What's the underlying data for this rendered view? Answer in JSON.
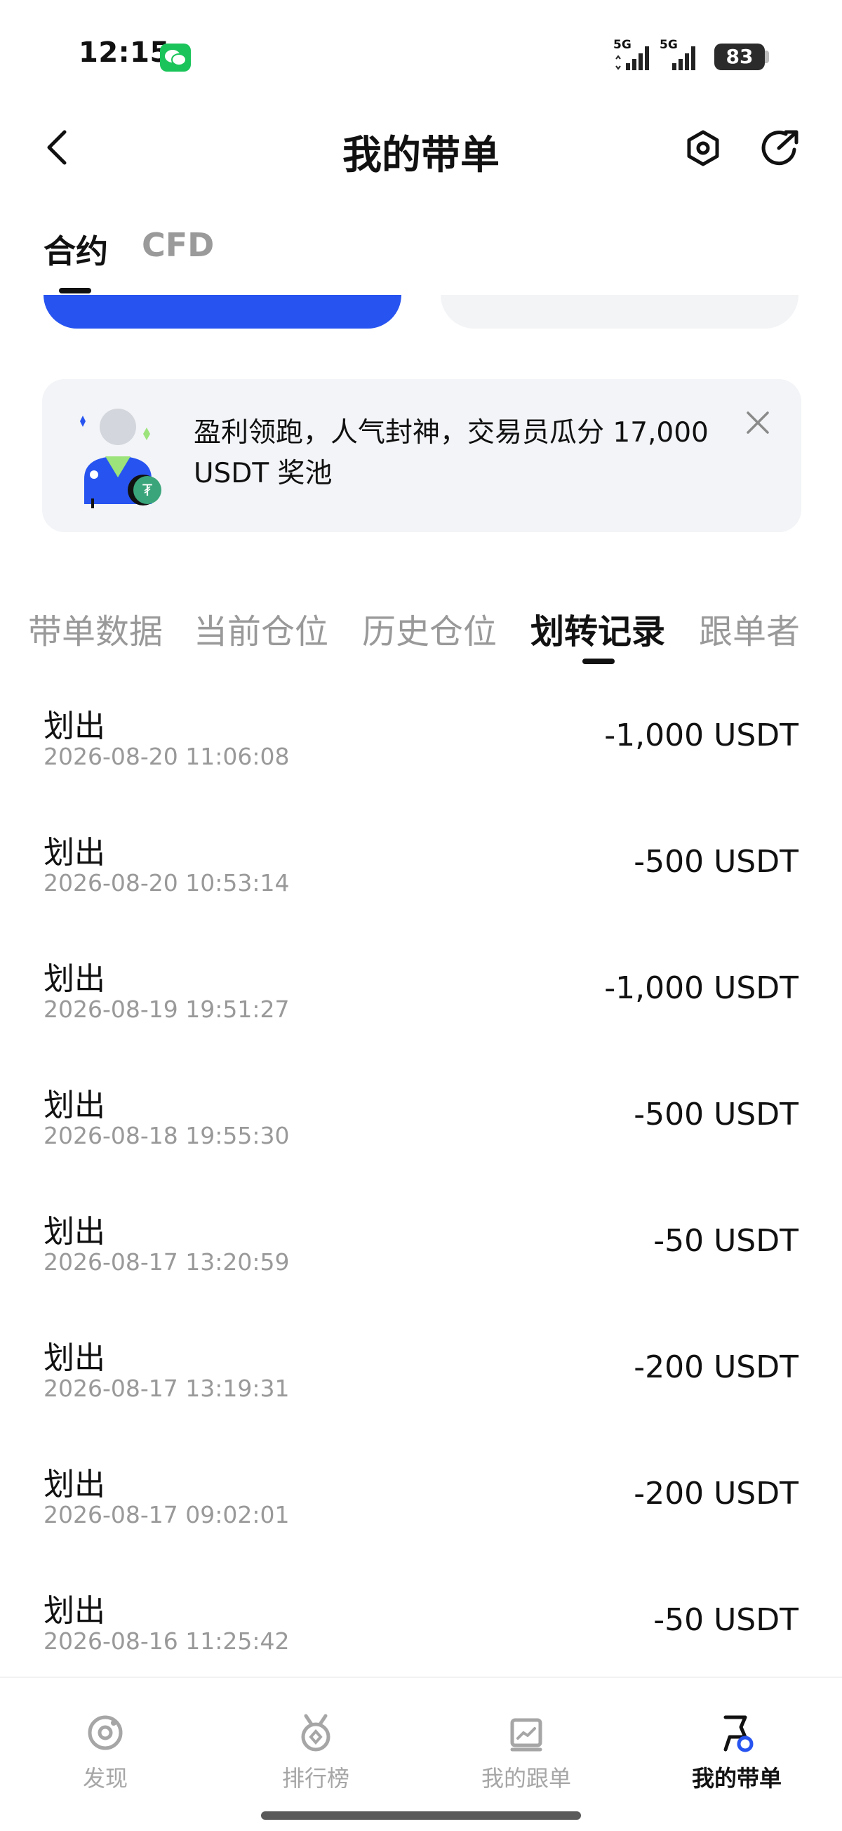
{
  "status_bar": {
    "time": "12:15",
    "signal_1": "5G",
    "signal_2": "5G",
    "battery": "83"
  },
  "header": {
    "title": "我的带单"
  },
  "top_tabs": [
    {
      "label": "合约",
      "active": true
    },
    {
      "label": "CFD",
      "active": false
    }
  ],
  "promo": {
    "text": "盈利领跑，人气封神，交易员瓜分 17,000 USDT 奖池"
  },
  "section_tabs": [
    {
      "label": "带单数据",
      "active": false
    },
    {
      "label": "当前仓位",
      "active": false
    },
    {
      "label": "历史仓位",
      "active": false
    },
    {
      "label": "划转记录",
      "active": true
    },
    {
      "label": "跟单者",
      "active": false
    }
  ],
  "records": [
    {
      "type": "划出",
      "time": "2026-08-20 11:06:08",
      "amount": "-1,000 USDT"
    },
    {
      "type": "划出",
      "time": "2026-08-20 10:53:14",
      "amount": "-500 USDT"
    },
    {
      "type": "划出",
      "time": "2026-08-19 19:51:27",
      "amount": "-1,000 USDT"
    },
    {
      "type": "划出",
      "time": "2026-08-18 19:55:30",
      "amount": "-500 USDT"
    },
    {
      "type": "划出",
      "time": "2026-08-17 13:20:59",
      "amount": "-50 USDT"
    },
    {
      "type": "划出",
      "time": "2026-08-17 13:19:31",
      "amount": "-200 USDT"
    },
    {
      "type": "划出",
      "time": "2026-08-17 09:02:01",
      "amount": "-200 USDT"
    },
    {
      "type": "划出",
      "time": "2026-08-16 11:25:42",
      "amount": "-50 USDT"
    }
  ],
  "bottom_nav": [
    {
      "label": "发现",
      "icon": "discover-icon",
      "active": false
    },
    {
      "label": "排行榜",
      "icon": "medal-icon",
      "active": false
    },
    {
      "label": "我的跟单",
      "icon": "chart-icon",
      "active": false
    },
    {
      "label": "我的带单",
      "icon": "flag-icon",
      "active": true
    }
  ],
  "colors": {
    "accent_blue": "#2754f0",
    "muted_text": "#999999",
    "wechat_green": "#1bc45a"
  }
}
